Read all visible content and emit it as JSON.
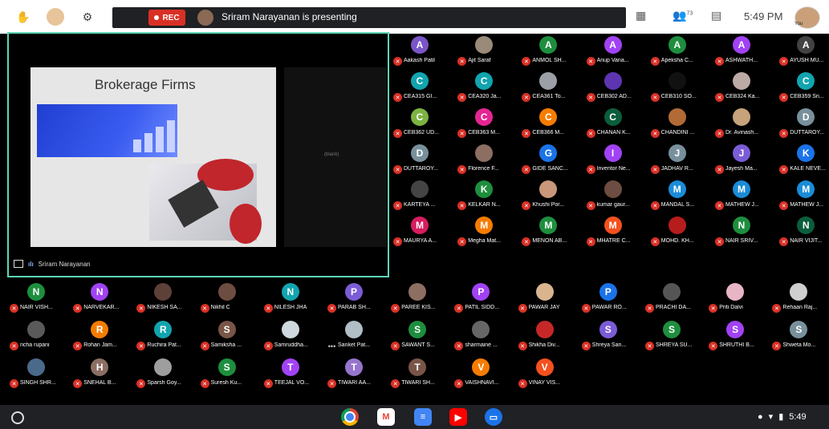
{
  "topbar": {
    "rec_label": "REC",
    "presenting": "Sriram Narayanan is presenting",
    "clock": "5:49 PM",
    "you_label": "You",
    "people_badge": "73",
    "accent": "#d93025"
  },
  "presentation": {
    "slide_title": "Brokerage Firms",
    "blank_label": "(blank)",
    "presenter_name": "Sriram Narayanan",
    "border_color": "#5fd4b5"
  },
  "participants": [
    {
      "initial": "A",
      "name": "Aakash Patil",
      "color": "#7a55c7"
    },
    {
      "initial": "",
      "name": "Ajit Saraf",
      "color": "#9a8a7a"
    },
    {
      "initial": "A",
      "name": "ANMOL SH...",
      "color": "#1e8e3e"
    },
    {
      "initial": "A",
      "name": "Anup Vana...",
      "color": "#a142f4"
    },
    {
      "initial": "A",
      "name": "Apeksha C...",
      "color": "#1e8e3e"
    },
    {
      "initial": "A",
      "name": "ASHWATH...",
      "color": "#a142f4"
    },
    {
      "initial": "A",
      "name": "AYUSH MU...",
      "color": "#424242"
    },
    {
      "initial": "C",
      "name": "CEA315 GI...",
      "color": "#12a4af"
    },
    {
      "initial": "C",
      "name": "CEA320 Ja...",
      "color": "#12a4af"
    },
    {
      "initial": "",
      "name": "CEA361 To...",
      "color": "#9aa0a6"
    },
    {
      "initial": "",
      "name": "CEB302 AD...",
      "color": "#5e35b1"
    },
    {
      "initial": "",
      "name": "CEB310 SO...",
      "color": "#111111"
    },
    {
      "initial": "",
      "name": "CEB324 Ka...",
      "color": "#bcaaa4"
    },
    {
      "initial": "C",
      "name": "CEB359 Sri...",
      "color": "#12a4af"
    },
    {
      "initial": "C",
      "name": "CEB362 UD...",
      "color": "#7cb342"
    },
    {
      "initial": "C",
      "name": "CEB363 M...",
      "color": "#e52592"
    },
    {
      "initial": "C",
      "name": "CEB366 M...",
      "color": "#f57c00"
    },
    {
      "initial": "C",
      "name": "CHANAN K...",
      "color": "#0b5d3b"
    },
    {
      "initial": "",
      "name": "CHANDINI ...",
      "color": "#b26a36"
    },
    {
      "initial": "",
      "name": "Dr. Avinash...",
      "color": "#c8a27a"
    },
    {
      "initial": "D",
      "name": "DUTTAROY...",
      "color": "#78909c"
    },
    {
      "initial": "D",
      "name": "DUTTAROY...",
      "color": "#78909c"
    },
    {
      "initial": "",
      "name": "Florence F...",
      "color": "#8d6e63"
    },
    {
      "initial": "G",
      "name": "GIDE SANC...",
      "color": "#1a73e8"
    },
    {
      "initial": "I",
      "name": "Inventor Ne...",
      "color": "#a142f4"
    },
    {
      "initial": "J",
      "name": "JADHAV R...",
      "color": "#78909c"
    },
    {
      "initial": "J",
      "name": "Jayesh Ma...",
      "color": "#7b5cd6"
    },
    {
      "initial": "K",
      "name": "KALE NEVE...",
      "color": "#1a73e8"
    },
    {
      "initial": "",
      "name": "KARTEYA ...",
      "color": "#444444"
    },
    {
      "initial": "K",
      "name": "KELKAR N...",
      "color": "#1e8e3e"
    },
    {
      "initial": "",
      "name": "Khushi Por...",
      "color": "#c9977a"
    },
    {
      "initial": "",
      "name": "kumar gaur...",
      "color": "#6d4c41"
    },
    {
      "initial": "M",
      "name": "MANDAL S...",
      "color": "#1a8cd8"
    },
    {
      "initial": "M",
      "name": "MATHEW J...",
      "color": "#1a8cd8"
    },
    {
      "initial": "M",
      "name": "MATHEW J...",
      "color": "#1a8cd8"
    },
    {
      "initial": "M",
      "name": "MAURYA A...",
      "color": "#d81b60"
    },
    {
      "initial": "M",
      "name": "Megha Mat...",
      "color": "#f57c00"
    },
    {
      "initial": "M",
      "name": "MENON AB...",
      "color": "#1e8e3e"
    },
    {
      "initial": "M",
      "name": "MHATRE C...",
      "color": "#f4511e"
    },
    {
      "initial": "",
      "name": "MOHD. KH...",
      "color": "#b71c1c"
    },
    {
      "initial": "N",
      "name": "NAIR SRIV...",
      "color": "#1e8e3e"
    },
    {
      "initial": "N",
      "name": "NAIR VIJIT...",
      "color": "#0b5d3b"
    },
    {
      "initial": "N",
      "name": "NAIR VISH...",
      "color": "#1e8e3e"
    },
    {
      "initial": "N",
      "name": "NARVEKAR...",
      "color": "#a142f4"
    },
    {
      "initial": "",
      "name": "NIKESH SA...",
      "color": "#5d4037"
    },
    {
      "initial": "",
      "name": "Nikhil C",
      "color": "#6d4c41"
    },
    {
      "initial": "N",
      "name": "NILESH JHA",
      "color": "#12a4af"
    },
    {
      "initial": "P",
      "name": "PARAB SH...",
      "color": "#7b5cd6"
    },
    {
      "initial": "",
      "name": "PAREE KIS...",
      "color": "#8d6e63"
    },
    {
      "initial": "P",
      "name": "PATIL SIDD...",
      "color": "#a142f4"
    },
    {
      "initial": "",
      "name": "PAWAR JAY",
      "color": "#d9b48f"
    },
    {
      "initial": "P",
      "name": "PAWAR RO...",
      "color": "#1a73e8"
    },
    {
      "initial": "",
      "name": "PRACHI DA...",
      "color": "#555555"
    },
    {
      "initial": "",
      "name": "Priti Dalvi",
      "color": "#e8b5c5"
    },
    {
      "initial": "",
      "name": "Rehaan Raj...",
      "color": "#cfcfcf"
    },
    {
      "initial": "",
      "name": "richa rupani",
      "color": "#5a5a5a"
    },
    {
      "initial": "R",
      "name": "Rohan Jam...",
      "color": "#f57c00"
    },
    {
      "initial": "R",
      "name": "Ruchira Pat...",
      "color": "#12a4af"
    },
    {
      "initial": "S",
      "name": "Samiksha ...",
      "color": "#795548"
    },
    {
      "initial": "",
      "name": "Samruddha...",
      "color": "#cfd8dc"
    },
    {
      "initial": "",
      "name": "Sanket Pat...",
      "color": "#b0bec5",
      "dots": true
    },
    {
      "initial": "S",
      "name": "SAWANT S...",
      "color": "#1e8e3e"
    },
    {
      "initial": "",
      "name": "sharmaine ...",
      "color": "#666666"
    },
    {
      "initial": "",
      "name": "Shikha Div...",
      "color": "#c62828"
    },
    {
      "initial": "S",
      "name": "Shreya San...",
      "color": "#7b5cd6"
    },
    {
      "initial": "S",
      "name": "SHREYA SU...",
      "color": "#1e8e3e"
    },
    {
      "initial": "S",
      "name": "SHRUTHI B...",
      "color": "#a142f4"
    },
    {
      "initial": "S",
      "name": "Shweta Mo...",
      "color": "#78909c"
    },
    {
      "initial": "",
      "name": "SINGH SHR...",
      "color": "#4a6a8a"
    },
    {
      "initial": "H",
      "name": "SNEHAL B...",
      "color": "#8d6e63"
    },
    {
      "initial": "",
      "name": "Sparsh Goy...",
      "color": "#9e9e9e"
    },
    {
      "initial": "S",
      "name": "Suresh Ku...",
      "color": "#1e8e3e"
    },
    {
      "initial": "T",
      "name": "TEEJAL VO...",
      "color": "#a142f4"
    },
    {
      "initial": "T",
      "name": "TIWARI AA...",
      "color": "#9575cd"
    },
    {
      "initial": "T",
      "name": "TIWARI SH...",
      "color": "#795548"
    },
    {
      "initial": "V",
      "name": "VAISHNAVI...",
      "color": "#f57c00"
    },
    {
      "initial": "V",
      "name": "VINAY VIS...",
      "color": "#f4511e"
    }
  ],
  "shelf": {
    "apps": [
      {
        "name": "chrome",
        "color": "#db4437"
      },
      {
        "name": "gmail",
        "color": "#ffffff"
      },
      {
        "name": "docs",
        "color": "#4285f4"
      },
      {
        "name": "youtube",
        "color": "#ff0000"
      },
      {
        "name": "files",
        "color": "#1a73e8"
      }
    ],
    "time": "5:49"
  }
}
